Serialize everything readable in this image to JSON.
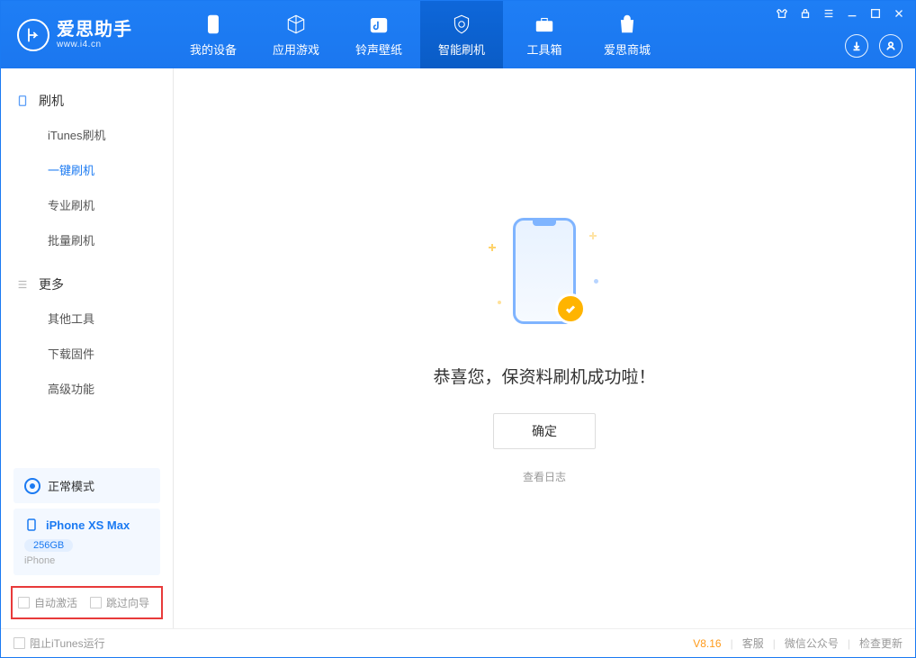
{
  "app": {
    "title": "爱思助手",
    "subtitle": "www.i4.cn"
  },
  "nav": {
    "items": [
      {
        "label": "我的设备"
      },
      {
        "label": "应用游戏"
      },
      {
        "label": "铃声壁纸"
      },
      {
        "label": "智能刷机"
      },
      {
        "label": "工具箱"
      },
      {
        "label": "爱思商城"
      }
    ]
  },
  "sidebar": {
    "group_flash": "刷机",
    "items_flash": [
      {
        "label": "iTunes刷机"
      },
      {
        "label": "一键刷机"
      },
      {
        "label": "专业刷机"
      },
      {
        "label": "批量刷机"
      }
    ],
    "group_more": "更多",
    "items_more": [
      {
        "label": "其他工具"
      },
      {
        "label": "下载固件"
      },
      {
        "label": "高级功能"
      }
    ],
    "mode": "正常模式",
    "device_name": "iPhone XS Max",
    "device_storage": "256GB",
    "device_type": "iPhone",
    "opt_activate": "自动激活",
    "opt_skip": "跳过向导"
  },
  "main": {
    "headline": "恭喜您，保资料刷机成功啦！",
    "ok": "确定",
    "view_log": "查看日志"
  },
  "status": {
    "block_itunes": "阻止iTunes运行",
    "version": "V8.16",
    "support": "客服",
    "wechat": "微信公众号",
    "update": "检查更新"
  }
}
